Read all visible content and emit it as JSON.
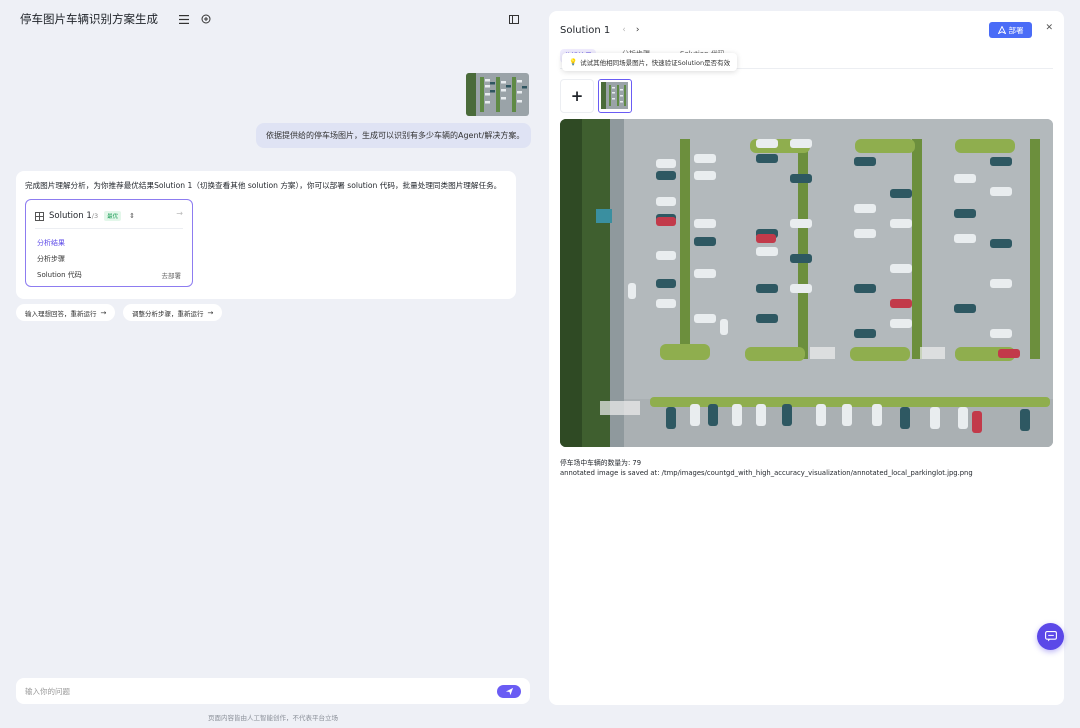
{
  "app": {
    "title": "停车图片车辆识别方案生成"
  },
  "chat": {
    "user_message": "依据提供给的停车场图片，生成可以识别有多少车辆的Agent/解决方案。",
    "assistant_message": "完成图片理解分析，为你推荐最优结果Solution 1（切换查看其他 solution 方案），你可以部署 solution 代码，批量处理同类图片理解任务。",
    "solution_card": {
      "name": "Solution 1",
      "count": "/3",
      "badge": "最优",
      "items": [
        {
          "label": "分析结果",
          "active": true
        },
        {
          "label": "分析步骤",
          "active": false
        },
        {
          "label": "Solution 代码",
          "active": false
        }
      ],
      "deploy_link": "去部署"
    },
    "suggestions": [
      "输入理想回答，重新运行",
      "调整分析步骤，重新运行"
    ],
    "input_placeholder": "输入你的问题",
    "disclaimer": "页面内容皆由人工智能创作，不代表平台立场"
  },
  "panel": {
    "title": "Solution 1",
    "deploy_label": "部署",
    "tabs": [
      "分析结果",
      "分析步骤",
      "Solution 代码"
    ],
    "tooltip": "试试其他相同场景图片，快速验证Solution是否有效",
    "result_line1": "停车场中车辆的数量为: 79",
    "result_line2": "annotated image is saved at: /tmp/images/countgd_with_high_accuracy_visualization/annotated_local_parkinglot.jpg.png"
  },
  "colors": {
    "accent": "#5b48e8",
    "deploy": "#4a6cf7",
    "badge_green": "#1a9c55"
  }
}
